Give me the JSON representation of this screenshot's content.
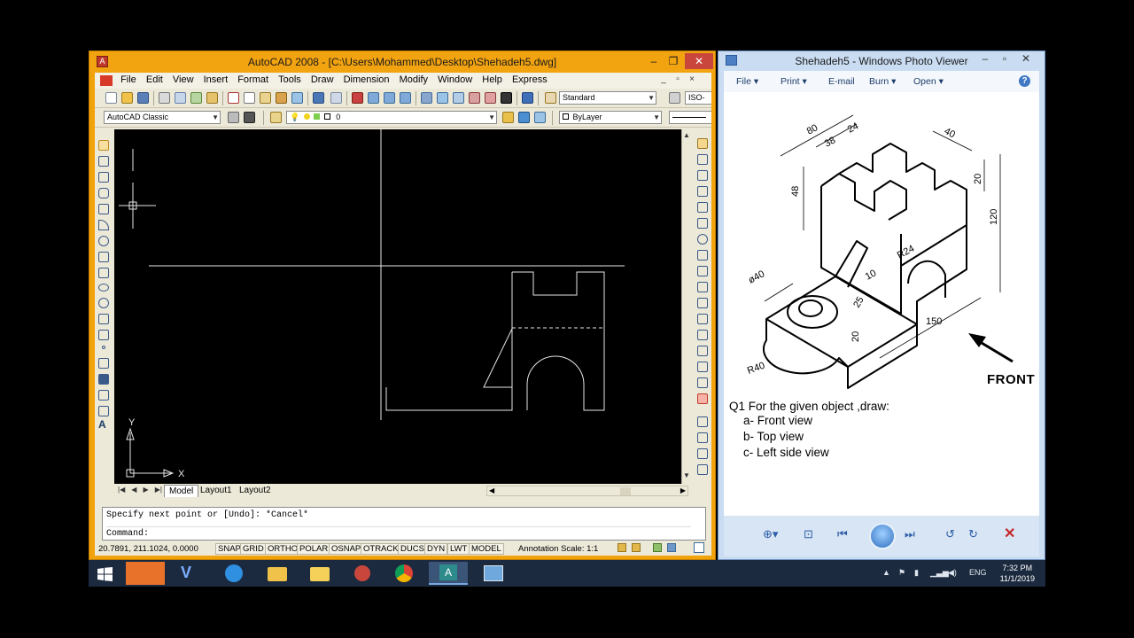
{
  "autocad": {
    "title": "AutoCAD 2008 - [C:\\Users\\Mohammed\\Desktop\\Shehadeh5.dwg]",
    "menu": [
      "File",
      "Edit",
      "View",
      "Insert",
      "Format",
      "Tools",
      "Draw",
      "Dimension",
      "Modify",
      "Window",
      "Help",
      "Express"
    ],
    "text_style": "Standard",
    "dim_style": "ISO-",
    "workspace": "AutoCAD Classic",
    "layer": "0",
    "color": "ByLayer",
    "axis_y": "Y",
    "axis_x": "X",
    "tabs": [
      "Model",
      "Layout1",
      "Layout2"
    ],
    "cmd_line1": "Specify next point or [Undo]: *Cancel*",
    "cmd_line2": "Command:",
    "coords": "20.7891, 211.1024, 0.0000",
    "status_buttons": [
      "SNAP",
      "GRID",
      "ORTHO",
      "POLAR",
      "OSNAP",
      "OTRACK",
      "DUCS",
      "DYN",
      "LWT",
      "MODEL"
    ],
    "annotation_scale": "Annotation Scale: 1:1"
  },
  "viewer": {
    "title": "Shehadeh5 - Windows Photo Viewer",
    "menu": [
      "File",
      "Print",
      "E-mail",
      "Burn",
      "Open"
    ],
    "help": "?",
    "dims": {
      "d80": "80",
      "d38": "38",
      "d24": "24",
      "d40": "40",
      "d48": "48",
      "d20a": "20",
      "d120": "120",
      "r24": "R24",
      "d10": "10",
      "d25": "25",
      "d40dia": "ø40",
      "d20b": "20",
      "d150": "150",
      "r40": "R40"
    },
    "front_label": "FRONT",
    "question": "Q1  For the given object  ,draw:",
    "items": [
      "a- Front view",
      "b- Top view",
      "c- Left   side view"
    ]
  },
  "taskbar": {
    "lang": "ENG",
    "time": "7:32 PM",
    "date": "11/1/2019"
  }
}
